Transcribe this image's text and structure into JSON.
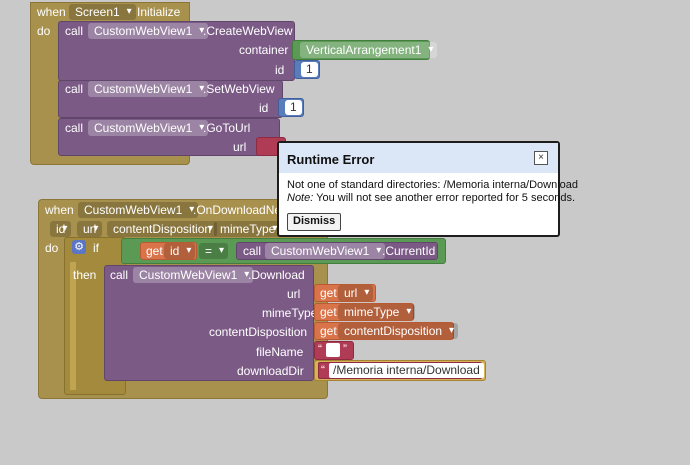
{
  "screen_init_block": {
    "when": "when",
    "component": "Screen1",
    "event": "Initialize",
    "do": "do",
    "call1": {
      "call": "call",
      "component": "CustomWebView1",
      "method": ".CreateWebView",
      "container_label": "container",
      "container_value": "VerticalArrangement1",
      "id_label": "id",
      "id_value": "1"
    },
    "call2": {
      "call": "call",
      "component": "CustomWebView1",
      "method": ".SetWebView",
      "id_label": "id",
      "id_value": "1"
    },
    "call3": {
      "call": "call",
      "component": "CustomWebView1",
      "method": ".GoToUrl",
      "url_label": "url"
    }
  },
  "download_block": {
    "when": "when",
    "component": "CustomWebView1",
    "event_partial": ".OnDownloadNee",
    "params": [
      "id",
      "url",
      "contentDisposition",
      "mimeType"
    ],
    "do": "do",
    "if": "if",
    "then": "then",
    "condition": {
      "get": "get",
      "var": "id",
      "op": "=",
      "call": "call",
      "component": "CustomWebView1",
      "prop": ".CurrentId"
    },
    "download_call": {
      "call": "call",
      "component": "CustomWebView1",
      "method": ".Download",
      "args": [
        {
          "label": "url",
          "get": "get",
          "value": "url"
        },
        {
          "label": "mimeType",
          "get": "get",
          "value": "mimeType"
        },
        {
          "label": "contentDisposition",
          "get": "get",
          "value": "contentDisposition"
        },
        {
          "label": "fileName",
          "value": ""
        },
        {
          "label": "downloadDir",
          "value": "/Memoria interna/Download"
        }
      ]
    }
  },
  "dialog": {
    "title": "Runtime Error",
    "close_glyph": "×",
    "message": "Not one of standard directories: /Memoria interna/Download",
    "note_label": "Note:",
    "note_text": " You will not see another error reported for 5 seconds.",
    "dismiss_label": "Dismiss"
  },
  "colors": {
    "workspace": "#c9c9c9",
    "event_block": "#a8904d",
    "procedure_block": "#7b5b86",
    "component_block": "#5b9a55",
    "number_block": "#5a7cbb",
    "getter_block": "#d9744a",
    "text_block": "#b03b55",
    "dialog_header": "#dbe7f7"
  }
}
